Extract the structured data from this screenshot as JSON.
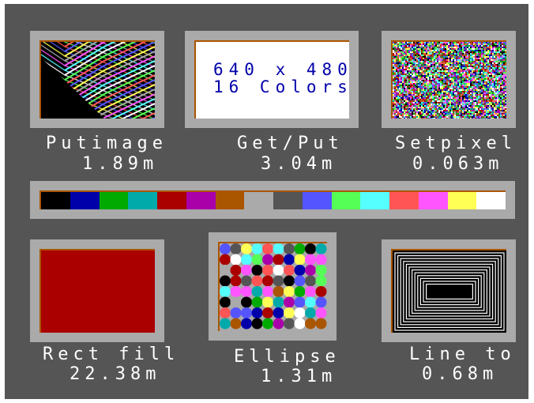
{
  "panels": {
    "putimage": {
      "title": "Putimage",
      "time": "1.89m"
    },
    "getput": {
      "title": "Get/Put",
      "time": "3.04m",
      "content_line1": "640 x 480",
      "content_line2": "16 Colors"
    },
    "setpixel": {
      "title": "Setpixel",
      "time": "0.063m"
    },
    "rectfill": {
      "title": "Rect fill",
      "time": "22.38m"
    },
    "ellipse": {
      "title": "Ellipse",
      "time": "1.31m"
    },
    "lineto": {
      "title": "Line to",
      "time": "0.68m"
    }
  },
  "palette": [
    "#000000",
    "#0000aa",
    "#00aa00",
    "#00aaaa",
    "#aa0000",
    "#aa00aa",
    "#aa5500",
    "#aaaaaa",
    "#555555",
    "#5555ff",
    "#55ff55",
    "#55ffff",
    "#ff5555",
    "#ff55ff",
    "#ffff55",
    "#ffffff"
  ],
  "colors": {
    "background": "#555555",
    "frame_orange": "#aa5500",
    "frame_gray": "#aaaaaa",
    "rect_fill": "#aa0000",
    "text": "#ffffff"
  }
}
